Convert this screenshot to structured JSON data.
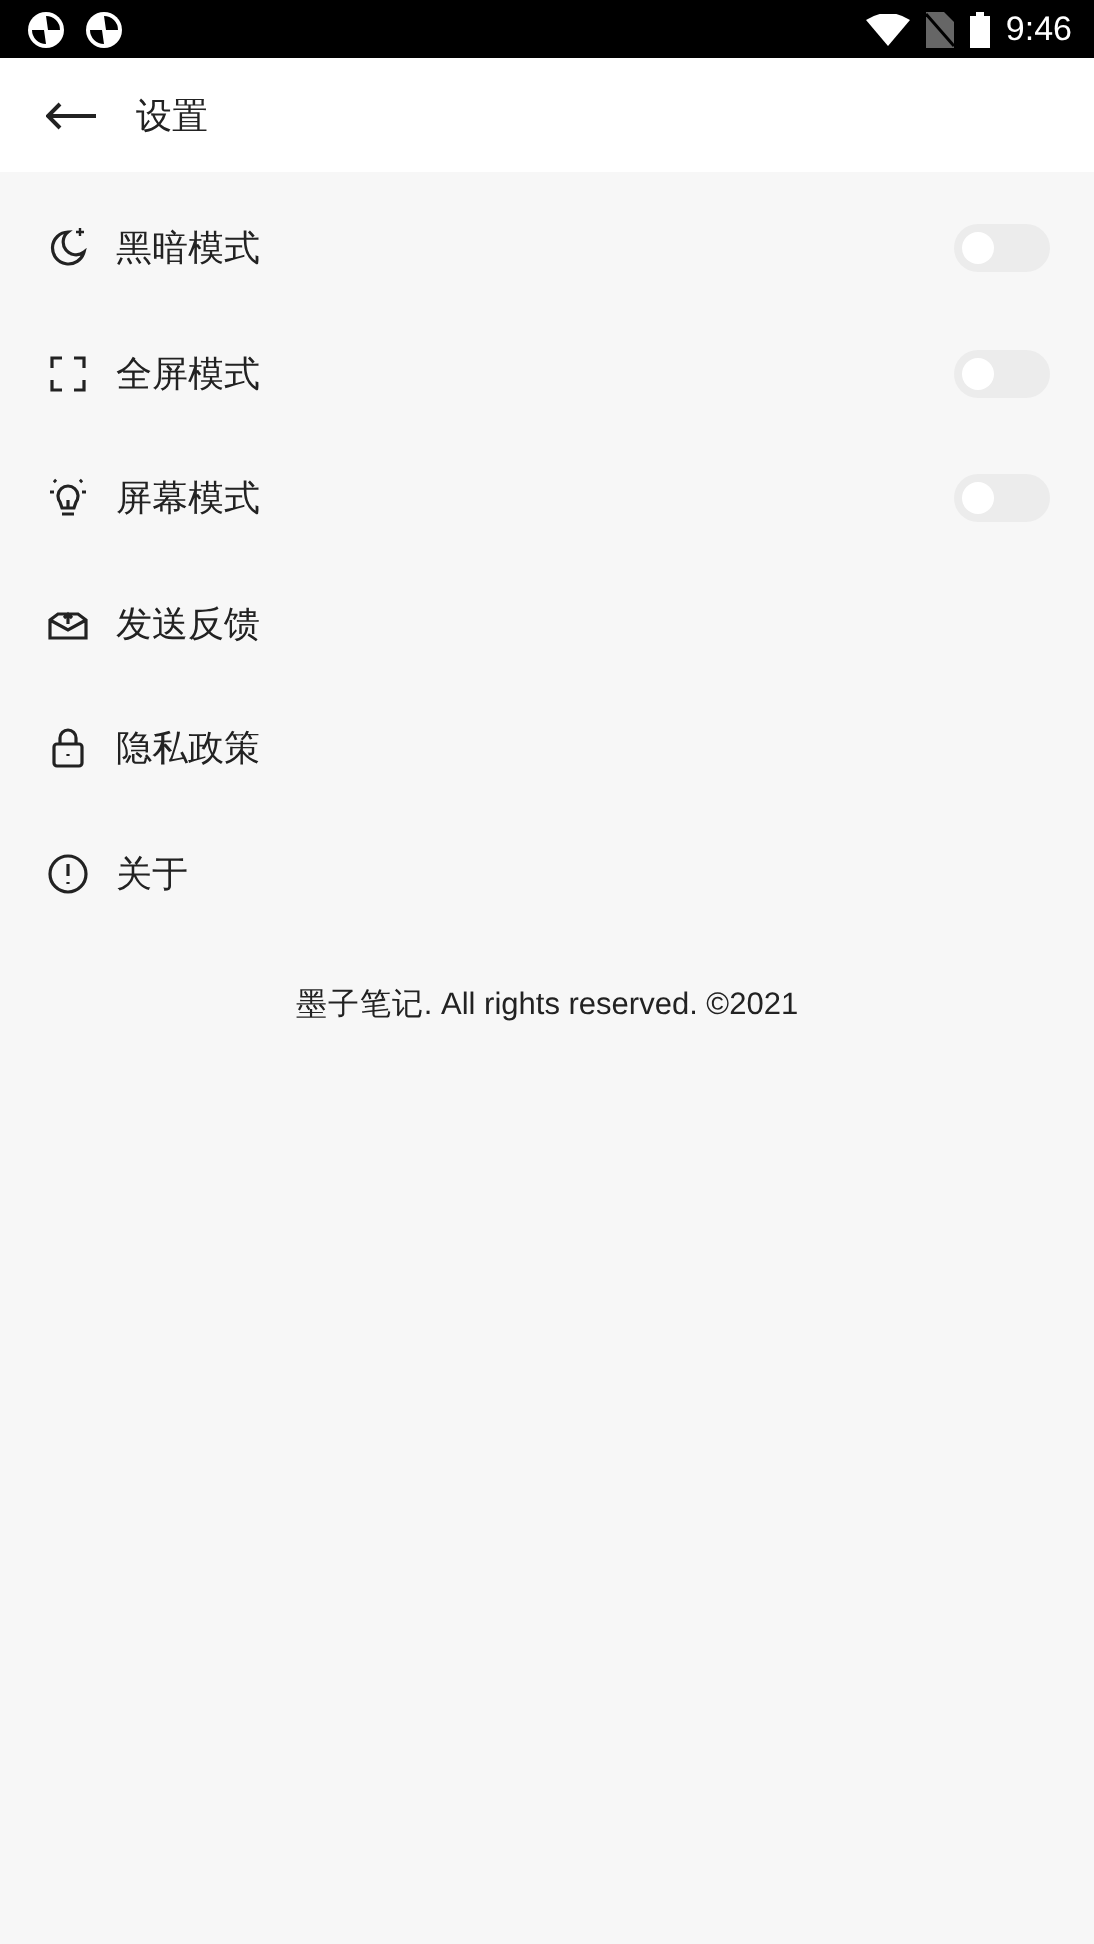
{
  "status_bar": {
    "time": "9:46"
  },
  "header": {
    "title": "设置"
  },
  "items": [
    {
      "label": "黑暗模式",
      "kind": "toggle",
      "on": false
    },
    {
      "label": "全屏模式",
      "kind": "toggle",
      "on": false
    },
    {
      "label": "屏幕模式",
      "kind": "toggle",
      "on": false
    },
    {
      "label": "发送反馈",
      "kind": "link"
    },
    {
      "label": "隐私政策",
      "kind": "link"
    },
    {
      "label": "关于",
      "kind": "link"
    }
  ],
  "footer": "墨子笔记. All rights reserved. ©2021"
}
